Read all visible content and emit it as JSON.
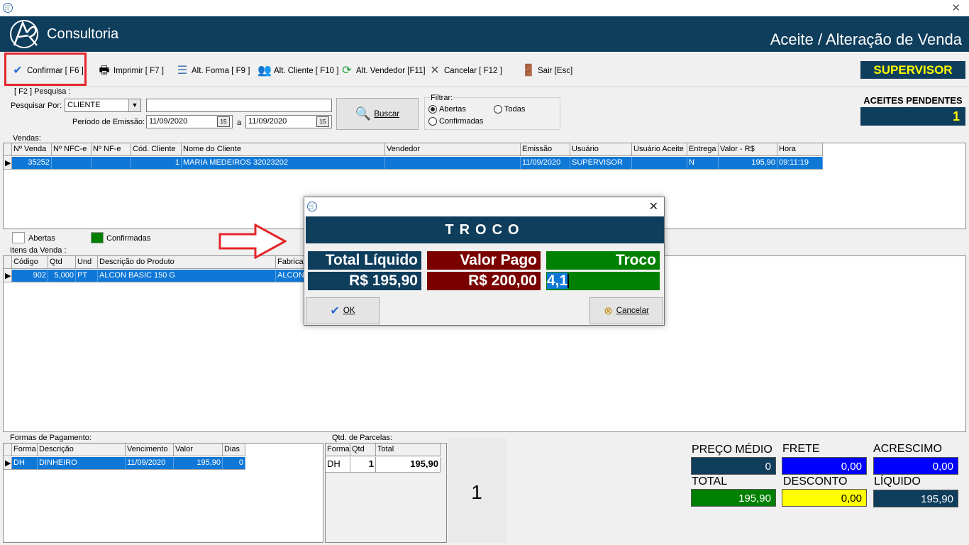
{
  "header": {
    "logo_text": "Consultoria",
    "title": "Aceite / Alteração de Venda"
  },
  "toolbar": {
    "confirm": "Confirmar [ F6 ]",
    "print": "Imprimir  [ F7 ]",
    "alt_forma": "Alt. Forma [ F9 ]",
    "alt_cliente": "Alt. Cliente [ F10 ]",
    "alt_vendedor": "Alt. Vendedor [F11]",
    "cancel": "Cancelar [ F12 ]",
    "exit": "Sair  [Esc]"
  },
  "user_badge": "SUPERVISOR",
  "search": {
    "group_label": "[ F2 ]  Pesquisa :",
    "search_by_label": "Pesquisar Por:",
    "search_by_value": "CLIENTE",
    "search_text": "",
    "period_label": "Período de Emissão:",
    "date_from": "11/09/2020",
    "to_label": "a",
    "date_to": "11/09/2020",
    "search_button": "Buscar",
    "filter_label": "Filtrar:",
    "filter_open": "Abertas",
    "filter_all": "Todas",
    "filter_confirmed": "Confirmadas",
    "filter_selected": "Abertas"
  },
  "pending": {
    "label": "ACEITES PENDENTES",
    "count": "1"
  },
  "sales": {
    "label": "Vendas:",
    "columns": [
      "Nº Venda",
      "Nº NFC-e",
      "Nº NF-e",
      "Cód. Cliente",
      "Nome do Cliente",
      "Vendedor",
      "Emissão",
      "Usuário",
      "Usuário Aceite",
      "Entrega",
      "Valor - R$",
      "Hora"
    ],
    "rows": [
      [
        "35252",
        "",
        "",
        "1",
        "MARIA MEDEIROS 32023202",
        "",
        "11/09/2020",
        "SUPERVISOR",
        "",
        "N",
        "195,90",
        "09:11:19"
      ]
    ]
  },
  "legend": {
    "open": "Abertas",
    "confirmed": "Confirmadas",
    "open_color": "#ffffff",
    "confirmed_color": "#008000"
  },
  "items": {
    "label": "Itens da Venda  :",
    "columns": [
      "Código",
      "Qtd",
      "Und",
      "Descrição do Produto",
      "Fabricante"
    ],
    "columns_visible": [
      "Código",
      "Qtd",
      "Und",
      "Descrição do Produto",
      "Fabricar"
    ],
    "rows": [
      [
        "902",
        "5,000",
        "PT",
        "ALCON BASIC 150 G",
        "ALCON"
      ]
    ]
  },
  "payments": {
    "label": "Formas de Pagamento:",
    "columns": [
      "Forma",
      "Descrição",
      "Vencimento",
      "Valor",
      "Dias"
    ],
    "rows": [
      [
        "DH",
        "DINHEIRO",
        "11/09/2020",
        "195,90",
        "0"
      ]
    ]
  },
  "installments": {
    "label": "Qtd. de Parcelas:",
    "columns": [
      "Forma",
      "Qtd",
      "Total"
    ],
    "rows": [
      [
        "DH",
        "1",
        "195,90"
      ]
    ],
    "big_number": "1"
  },
  "totals": {
    "avg_price_label": "PREÇO MÉDIO",
    "avg_price": "0",
    "freight_label": "FRETE",
    "freight": "0,00",
    "addition_label": "ACRESCIMO",
    "addition": "0,00",
    "total_label": "TOTAL",
    "total": "195,90",
    "discount_label": "DESCONTO",
    "discount": "0,00",
    "net_label": "LÍQUIDO",
    "net": "195,90"
  },
  "dialog": {
    "heading": "TROCO",
    "net_label": "Total Líquido",
    "net_value": "R$ 195,90",
    "paid_label": "Valor Pago",
    "paid_value": "R$ 200,00",
    "change_label": "Troco",
    "change_value": "4,1",
    "ok": "OK",
    "cancel": "Cancelar"
  },
  "colors": {
    "navy": "#0f3d5c",
    "maroon": "#7a0000",
    "green": "#008000",
    "selection": "#0f78d7",
    "yellow": "#ffff00",
    "blue": "#0000ff",
    "highlight_red": "#e3272b"
  }
}
